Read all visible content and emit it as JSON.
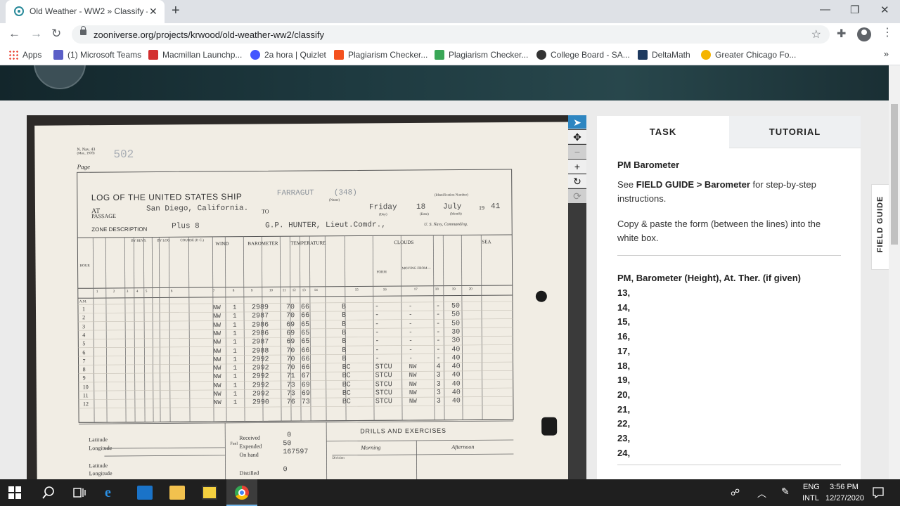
{
  "browser": {
    "tab_title": "Old Weather - WW2 » Classify —",
    "url": "zooniverse.org/projects/krwood/old-weather-ww2/classify",
    "bookmarks": [
      {
        "label": "Apps",
        "color": "#4285f4"
      },
      {
        "label": "(1) Microsoft Teams",
        "color": "#5b5fc7"
      },
      {
        "label": "Macmillan Launchp...",
        "color": "#d32f2f"
      },
      {
        "label": "2a hora | Quizlet",
        "color": "#4255ff"
      },
      {
        "label": "Plagiarism Checker...",
        "color": "#f4511e"
      },
      {
        "label": "Plagiarism Checker...",
        "color": "#3aa757"
      },
      {
        "label": "College Board - SA...",
        "color": "#333333"
      },
      {
        "label": "DeltaMath",
        "color": "#1e3a5f"
      },
      {
        "label": "Greater Chicago Fo...",
        "color": "#f5b400"
      }
    ]
  },
  "logsheet": {
    "form_number": "N. Nav. 43",
    "form_date": "(Mar., 1939)",
    "page_label": "Page",
    "page_number": "502",
    "header": "LOG OF THE UNITED STATES SHIP",
    "ship_name": "FARRAGUT",
    "hull_number": "(348)",
    "name_caption": "(Name)",
    "ident_caption": "(Identification Number)",
    "at_label": "AT",
    "passage_label": "PASSAGE",
    "to_label": "TO",
    "location": "San Diego, California.",
    "day": "Friday",
    "date": "18",
    "month": "July",
    "year_prefix": "19",
    "year": "41",
    "day_caption": "(Day)",
    "date_caption": "(Date)",
    "month_caption": "(Month)",
    "zone_label": "ZONE DESCRIPTION",
    "zone": "Plus 8",
    "commander": "G.P. HUNTER, Lieut.Comdr.,",
    "commanding_caption": "U. S. Navy, Commanding.",
    "col_headers": {
      "hour": "HOUR",
      "all_chart": "\"ALL CHART\" AVERAGE SPEED",
      "by_revs": "BY REVS.",
      "by_log": "BY LOG",
      "course": "COURSE (P. C.)",
      "wind": "WIND",
      "barometer": "BAROMETER",
      "temperature": "TEMPERATURE",
      "weather": "WEATHER, BY SYMBOLS",
      "clouds": "CLOUDS",
      "sea": "SEA",
      "direction": "DIRECTION",
      "force": "FORCE",
      "height": "HEIGHT IN INCHES",
      "reading": "READING AT. THER.",
      "dry": "AIR DRY BULB",
      "wet": "AIR WET BULB",
      "water": "WATER AT SURFACE",
      "form": "FORM",
      "moving": "MOVING FROM—",
      "amount": "AMOUNT",
      "visibility": "VISIBILITY",
      "condition": "CONDITION",
      "swells": "SWELLS FROM—"
    },
    "col_numbers": [
      "1",
      "2",
      "3",
      "4",
      "5",
      "6",
      "7",
      "8",
      "9",
      "10",
      "11",
      "12",
      "13",
      "14",
      "15",
      "16",
      "17",
      "18",
      "19",
      "20"
    ],
    "am_label": "A.M.",
    "rows": [
      {
        "h": "1",
        "dir": "NW",
        "f": "1",
        "bar": "2989",
        "dry": "70",
        "wet": "66",
        "wx": "B",
        "form": "-",
        "mov": "-",
        "amt": "-",
        "vis": "50"
      },
      {
        "h": "2",
        "dir": "NW",
        "f": "1",
        "bar": "2987",
        "dry": "70",
        "wet": "66",
        "wx": "B",
        "form": "-",
        "mov": "-",
        "amt": "-",
        "vis": "50"
      },
      {
        "h": "3",
        "dir": "NW",
        "f": "1",
        "bar": "2986",
        "dry": "69",
        "wet": "65",
        "wx": "B",
        "form": "-",
        "mov": "-",
        "amt": "-",
        "vis": "50"
      },
      {
        "h": "4",
        "dir": "NW",
        "f": "1",
        "bar": "2986",
        "dry": "69",
        "wet": "65",
        "wx": "B",
        "form": "-",
        "mov": "-",
        "amt": "-",
        "vis": "30"
      },
      {
        "h": "5",
        "dir": "NW",
        "f": "1",
        "bar": "2987",
        "dry": "69",
        "wet": "65",
        "wx": "B",
        "form": "-",
        "mov": "-",
        "amt": "-",
        "vis": "30"
      },
      {
        "h": "6",
        "dir": "NW",
        "f": "1",
        "bar": "2988",
        "dry": "70",
        "wet": "66",
        "wx": "B",
        "form": "-",
        "mov": "-",
        "amt": "-",
        "vis": "40"
      },
      {
        "h": "7",
        "dir": "NW",
        "f": "1",
        "bar": "2992",
        "dry": "70",
        "wet": "66",
        "wx": "B",
        "form": "-",
        "mov": "-",
        "amt": "-",
        "vis": "40"
      },
      {
        "h": "8",
        "dir": "NW",
        "f": "1",
        "bar": "2992",
        "dry": "70",
        "wet": "66",
        "wx": "BC",
        "form": "STCU",
        "mov": "NW",
        "amt": "4",
        "vis": "40"
      },
      {
        "h": "9",
        "dir": "NW",
        "f": "1",
        "bar": "2992",
        "dry": "71",
        "wet": "67",
        "wx": "BC",
        "form": "STCU",
        "mov": "NW",
        "amt": "3",
        "vis": "40"
      },
      {
        "h": "10",
        "dir": "NW",
        "f": "1",
        "bar": "2992",
        "dry": "73",
        "wet": "69",
        "wx": "BC",
        "form": "STCU",
        "mov": "NW",
        "amt": "3",
        "vis": "40"
      },
      {
        "h": "11",
        "dir": "NW",
        "f": "1",
        "bar": "2992",
        "dry": "73",
        "wet": "69",
        "wx": "BC",
        "form": "STCU",
        "mov": "NW",
        "amt": "3",
        "vis": "40"
      },
      {
        "h": "12",
        "dir": "NW",
        "f": "1",
        "bar": "2990",
        "dry": "76",
        "wet": "73",
        "wx": "BC",
        "form": "STCU",
        "mov": "NW",
        "amt": "3",
        "vis": "40"
      }
    ],
    "lower": {
      "latitude": "Latitude",
      "longitude": "Longitude",
      "fuel_label": "Fuel",
      "received_label": "Received",
      "received": "0",
      "expended_label": "Expended",
      "expended": "50",
      "on_hand_label": "On hand",
      "on_hand": "167597",
      "distilled_label": "Distilled",
      "distilled": "0",
      "drills": "DRILLS AND EXERCISES",
      "morning": "Morning",
      "afternoon": "Afternoon",
      "division": "Division"
    }
  },
  "panel": {
    "tab_task": "TASK",
    "tab_tutorial": "TUTORIAL",
    "title": "PM Barometer",
    "para1_pre": "See ",
    "para1_bold": "FIELD GUIDE > Barometer",
    "para1_post": " for step-by-step instructions.",
    "para2": "Copy & paste the form (between the lines) into the white box.",
    "form_header": "PM, Barometer (Height), At. Ther. (if given)",
    "form_lines": [
      "13,",
      "14,",
      "15,",
      "16,",
      "17,",
      "18,",
      "19,",
      "20,",
      "21,",
      "22,",
      "23,",
      "24,"
    ],
    "field_guide": "FIELD GUIDE"
  },
  "taskbar": {
    "language": "ENG",
    "layout": "INTL",
    "time": "3:56 PM",
    "date": "12/27/2020"
  }
}
